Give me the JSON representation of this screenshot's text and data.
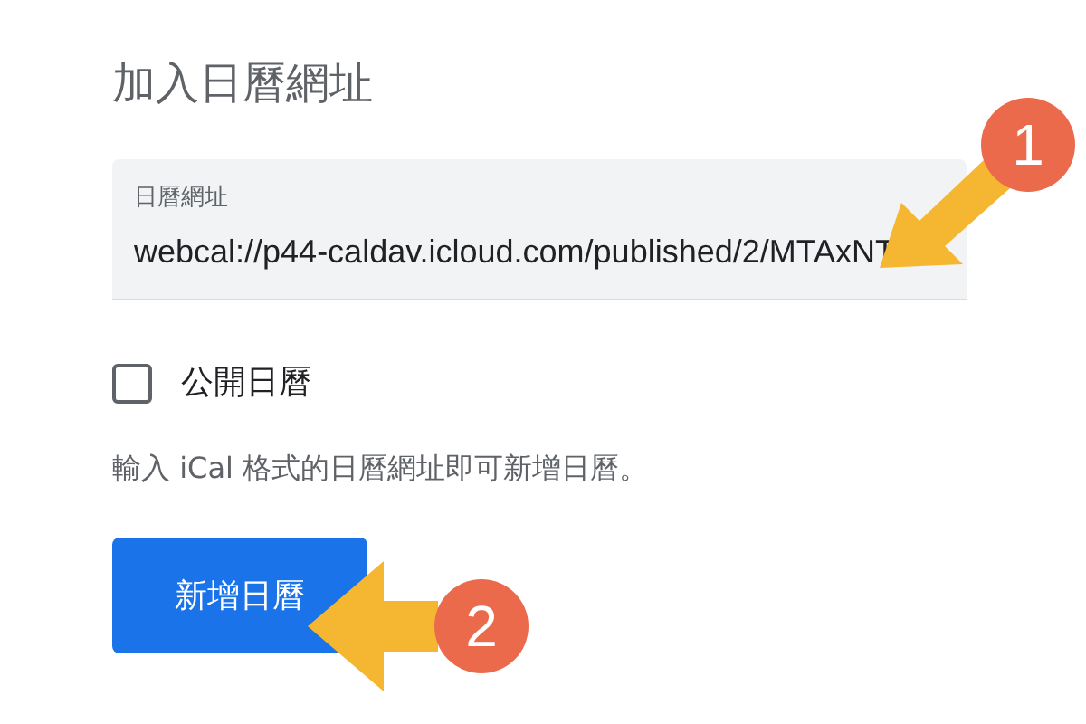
{
  "title": "加入日曆網址",
  "url_field": {
    "label": "日曆網址",
    "value": "webcal://p44-caldav.icloud.com/published/2/MTAxNT"
  },
  "public_checkbox": {
    "label": "公開日曆",
    "checked": false
  },
  "help_text": "輸入 iCal 格式的日曆網址即可新增日曆。",
  "add_button": {
    "label": "新增日曆"
  },
  "annotations": [
    {
      "number": "1"
    },
    {
      "number": "2"
    }
  ]
}
